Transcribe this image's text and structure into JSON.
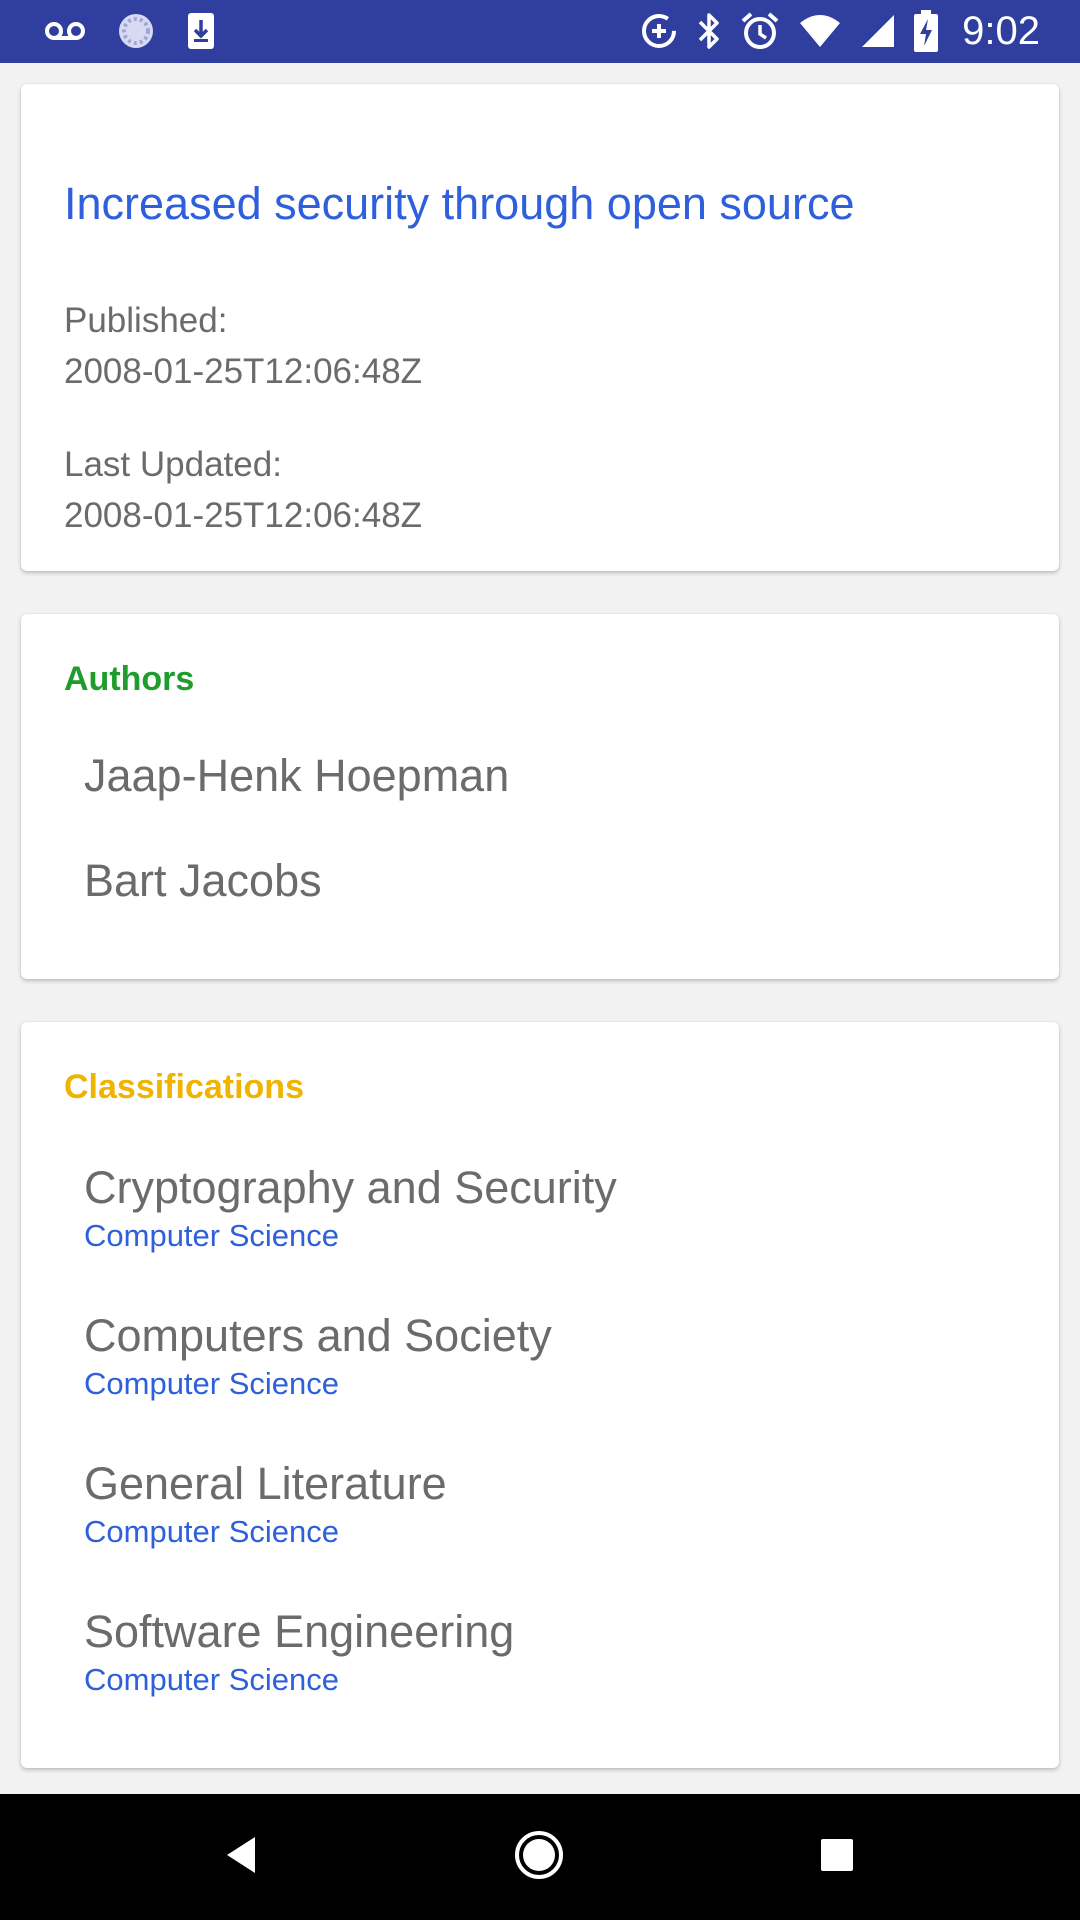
{
  "status_bar": {
    "time": "9:02",
    "icons_left": [
      "voicemail-icon",
      "sync-icon",
      "download-icon"
    ],
    "icons_right": [
      "data-saver-icon",
      "bluetooth-icon",
      "alarm-icon",
      "wifi-icon",
      "signal-icon",
      "battery-charging-icon"
    ]
  },
  "paper": {
    "title": "Increased security through open source",
    "published_label": "Published:",
    "published_value": "2008-01-25T12:06:48Z",
    "updated_label": "Last Updated:",
    "updated_value": "2008-01-25T12:06:48Z"
  },
  "authors": {
    "heading": "Authors",
    "heading_color": "#1e9c2c",
    "items": [
      "Jaap-Henk Hoepman",
      "Bart Jacobs"
    ]
  },
  "classifications": {
    "heading": "Classifications",
    "heading_color": "#f0b400",
    "items": [
      {
        "name": "Cryptography and Security",
        "category": "Computer Science"
      },
      {
        "name": "Computers and Society",
        "category": "Computer Science"
      },
      {
        "name": "General Literature",
        "category": "Computer Science"
      },
      {
        "name": "Software Engineering",
        "category": "Computer Science"
      }
    ]
  },
  "nav_bar": {
    "icons": [
      "back-icon",
      "home-icon",
      "recents-icon"
    ]
  }
}
